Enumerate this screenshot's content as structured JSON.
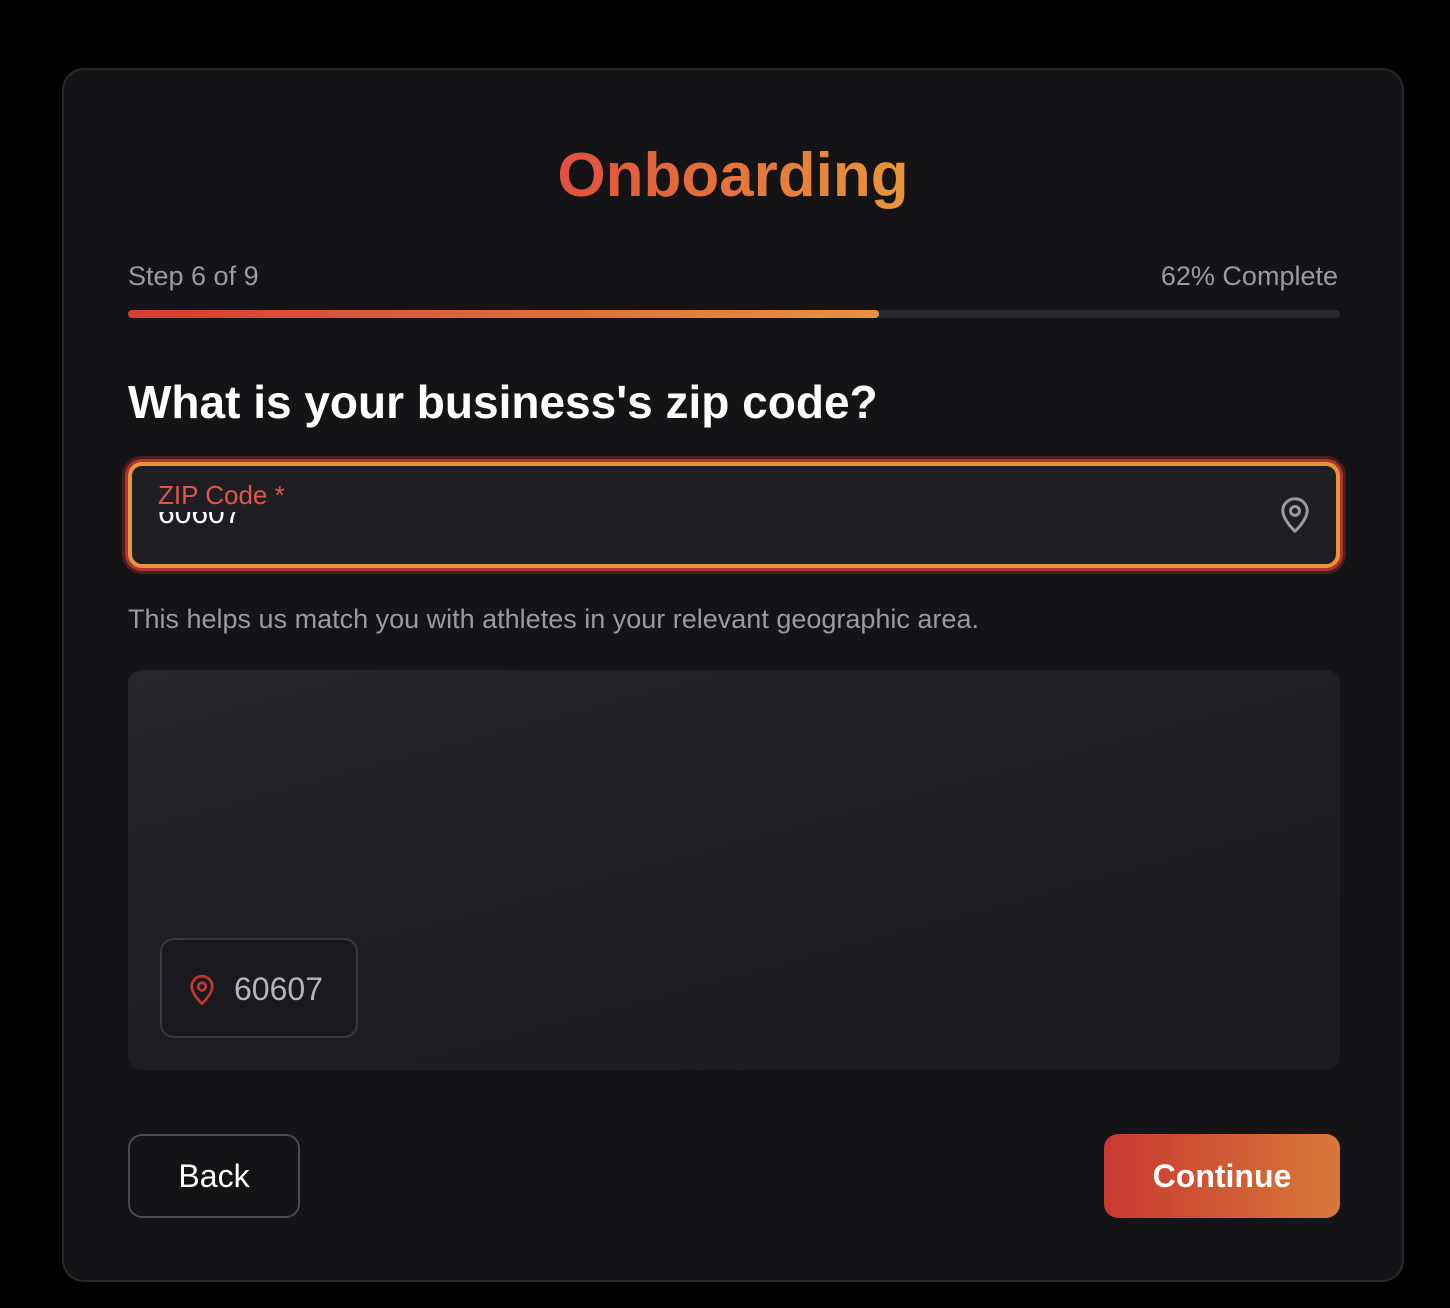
{
  "header": {
    "title": "Onboarding"
  },
  "progress": {
    "step_text": "Step 6 of 9",
    "percent_text": "62% Complete",
    "fraction": 0.62
  },
  "question": {
    "text": "What is your business's zip code?"
  },
  "zip_field": {
    "label": "ZIP Code *",
    "value": "60607",
    "icon": "map-pin-icon"
  },
  "helper_text": "This helps us match you with athletes in your relevant geographic area.",
  "map_preview": {
    "chip_icon": "map-pin-icon",
    "chip_text": "60607"
  },
  "actions": {
    "back_label": "Back",
    "continue_label": "Continue"
  },
  "colors": {
    "accent_start": "#d63c36",
    "accent_end": "#e8933a",
    "background": "#000000",
    "card": "#141416"
  }
}
